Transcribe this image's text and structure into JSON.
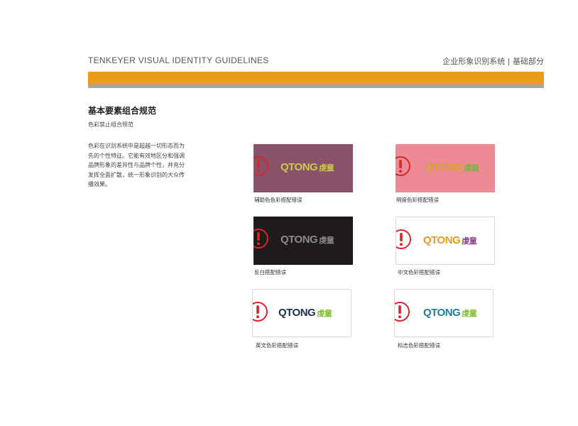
{
  "header": {
    "brand_guidelines": "TENKEYER VISUAL IDENTITY GUIDELINES",
    "section_path": "企业形象识别系统 |  基础部分"
  },
  "page": {
    "title": "基本要素组合规范",
    "subtitle": "色彩禁止组合规范",
    "description": "色彩在识别系统中是超越一切形态而为先的个性特征。它能有效地区分和强调品牌形象的差异性与品牌个性，并充分发挥全面扩散，统一形象识别的大众传播效果。"
  },
  "colors": {
    "accent_orange": "#eb9a1a",
    "divider_gray": "#a6a6a6",
    "warning_red": "#d8262b"
  },
  "logo": {
    "latin": "QTONG",
    "chinese": "虔童"
  },
  "samples": [
    {
      "caption": "辅助色色彩搭配错误",
      "bg": "#8a526a",
      "latin_color": "#c9c94a",
      "cn_color": "#c9c94a",
      "icon": "warning-exclamation-icon"
    },
    {
      "caption": "明度色彩搭配错误",
      "bg": "#ee8a95",
      "latin_color": "#d3a42a",
      "cn_color": "#7fb33a",
      "icon": "warning-exclamation-icon"
    },
    {
      "caption": "反白搭配错误",
      "bg": "#1f1b1a",
      "latin_color": "#8a8a8a",
      "cn_color": "#8a8a8a",
      "icon": "warning-exclamation-icon"
    },
    {
      "caption": "中文色彩搭配错误",
      "bg": "#ffffff",
      "latin_color": "#e69a22",
      "cn_color": "#8a3f8f",
      "icon": "warning-exclamation-icon"
    },
    {
      "caption": "英文色彩搭配错误",
      "bg": "#ffffff",
      "latin_color": "#1b3050",
      "cn_color": "#7bbd2b",
      "icon": "warning-exclamation-icon"
    },
    {
      "caption": "标志色彩搭配错误",
      "bg": "#ffffff",
      "latin_color": "#1f7f95",
      "cn_color": "#7bbd2b",
      "icon": "warning-exclamation-icon"
    }
  ]
}
